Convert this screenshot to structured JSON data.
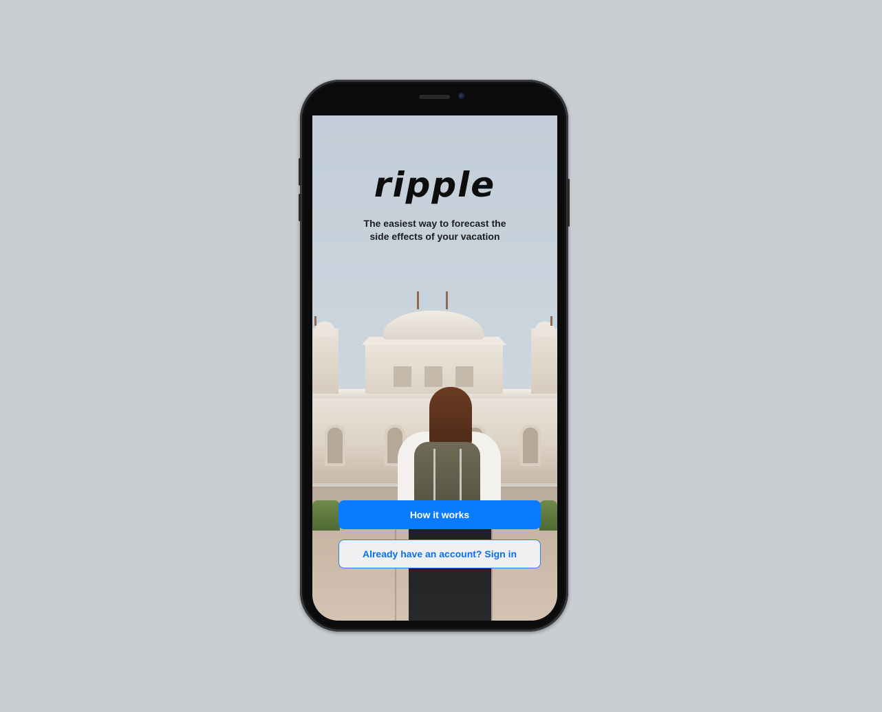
{
  "app": {
    "logo_text": "ripple",
    "tagline": "The easiest way to forecast the side effects of your vacation"
  },
  "actions": {
    "primary_label": "How it works",
    "secondary_label": "Already have an account? Sign in"
  },
  "colors": {
    "page_background": "#c9ced3",
    "primary_button": "#0a7bff",
    "secondary_button_text": "#0a6ff0",
    "secondary_button_border": "#2f7fe8",
    "phone_frame": "#0b0b0c"
  },
  "background_image": {
    "description_icon": "travel-photo"
  }
}
